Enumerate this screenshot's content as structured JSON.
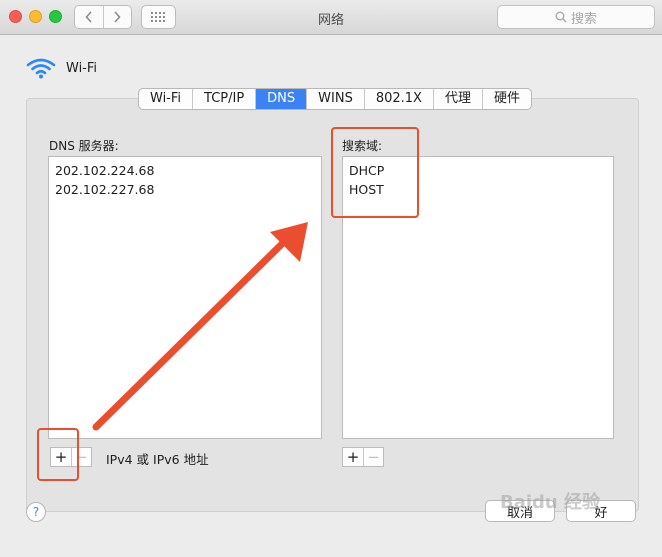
{
  "window": {
    "title": "网络",
    "search_placeholder": "搜索"
  },
  "interface": {
    "name": "Wi-Fi"
  },
  "tabs": [
    {
      "label": "Wi-Fi",
      "active": false
    },
    {
      "label": "TCP/IP",
      "active": false
    },
    {
      "label": "DNS",
      "active": true
    },
    {
      "label": "WINS",
      "active": false
    },
    {
      "label": "802.1X",
      "active": false
    },
    {
      "label": "代理",
      "active": false
    },
    {
      "label": "硬件",
      "active": false
    }
  ],
  "dns": {
    "label": "DNS 服务器:",
    "servers": [
      "202.102.224.68",
      "202.102.227.68"
    ],
    "add": "+",
    "remove": "−",
    "hint": "IPv4 或 IPv6 地址"
  },
  "search_domains": {
    "label": "搜索域:",
    "domains": [
      "DHCP",
      "HOST"
    ],
    "add": "+",
    "remove": "−"
  },
  "footer": {
    "help": "?",
    "cancel": "取消",
    "ok": "好"
  },
  "watermark": "Baidu 经验",
  "colors": {
    "accent": "#3b83f4",
    "annotation": "#ea4e2e",
    "close": "#fc5d57",
    "minimize": "#fdbc2e",
    "zoom": "#27c840"
  },
  "icons": [
    "wifi-icon",
    "search-icon",
    "grid-icon",
    "chevron-left-icon",
    "chevron-right-icon",
    "help-icon"
  ]
}
